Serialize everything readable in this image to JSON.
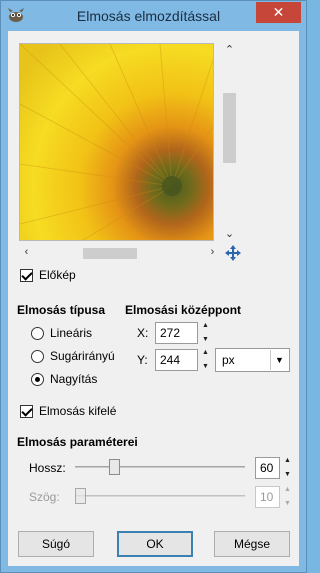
{
  "window": {
    "title": "Elmosás elmozdítással",
    "close_label": "✕"
  },
  "preview": {
    "checkbox_label": "Előkép",
    "checked": true
  },
  "blur_type": {
    "heading": "Elmosás típusa",
    "options": [
      {
        "label": "Lineáris",
        "checked": false
      },
      {
        "label": "Sugárirányú",
        "checked": false
      },
      {
        "label": "Nagyítás",
        "checked": true
      }
    ]
  },
  "center": {
    "heading": "Elmosási középpont",
    "x_label": "X:",
    "x_value": "272",
    "y_label": "Y:",
    "y_value": "244",
    "unit": "px"
  },
  "blur_outward": {
    "label": "Elmosás kifelé",
    "checked": true
  },
  "params": {
    "heading": "Elmosás paraméterei",
    "length_label": "Hossz:",
    "length_value": "60",
    "angle_label": "Szög:",
    "angle_value": "10"
  },
  "buttons": {
    "help": "Súgó",
    "ok": "OK",
    "cancel": "Mégse"
  }
}
